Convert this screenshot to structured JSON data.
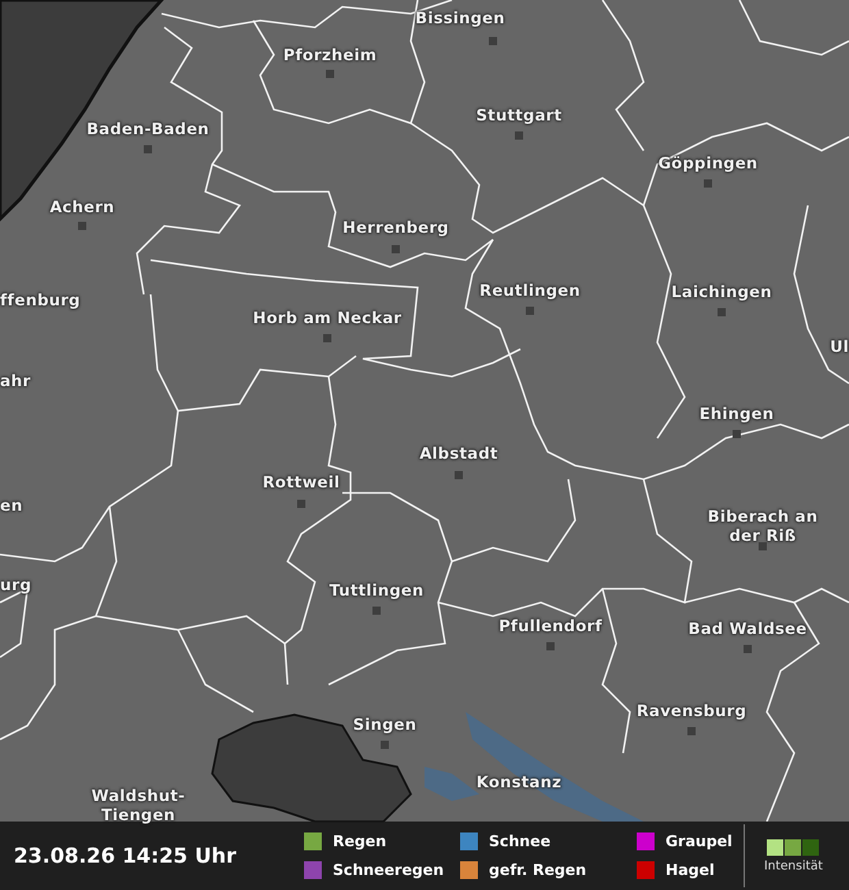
{
  "map": {
    "cities": [
      {
        "name": "Bissingen"
      },
      {
        "name": "Pforzheim"
      },
      {
        "name": "Baden-Baden"
      },
      {
        "name": "Stuttgart"
      },
      {
        "name": "Göppingen"
      },
      {
        "name": "Achern"
      },
      {
        "name": "Herrenberg"
      },
      {
        "name": "Reutlingen"
      },
      {
        "name": "Laichingen"
      },
      {
        "name": "ffenburg"
      },
      {
        "name": "Horb am Neckar"
      },
      {
        "name": "Ul"
      },
      {
        "name": "ahr"
      },
      {
        "name": "Ehingen"
      },
      {
        "name": "Albstadt"
      },
      {
        "name": "Rottweil"
      },
      {
        "name": "en"
      },
      {
        "name": "Biberach an der Riß"
      },
      {
        "name": "urg"
      },
      {
        "name": "Tuttlingen"
      },
      {
        "name": "Pfullendorf"
      },
      {
        "name": "Bad Waldsee"
      },
      {
        "name": "Ravensburg"
      },
      {
        "name": "Singen"
      },
      {
        "name": "Konstanz"
      },
      {
        "name": "Waldshut-Tiengen"
      }
    ]
  },
  "legend": {
    "timestamp": "23.08.26 14:25 Uhr",
    "items": [
      {
        "label": "Regen",
        "color": "#77a842"
      },
      {
        "label": "Schneeregen",
        "color": "#8e44ad"
      },
      {
        "label": "Schnee",
        "color": "#3d85c0"
      },
      {
        "label": "gefr. Regen",
        "color": "#d9843b"
      },
      {
        "label": "Graupel",
        "color": "#cc00cc"
      },
      {
        "label": "Hagel",
        "color": "#cc0000"
      }
    ],
    "intensity": {
      "label": "Intensität",
      "steps": [
        {
          "color": "#b3e283"
        },
        {
          "color": "#77a842"
        },
        {
          "color": "#2f6410"
        }
      ]
    }
  }
}
